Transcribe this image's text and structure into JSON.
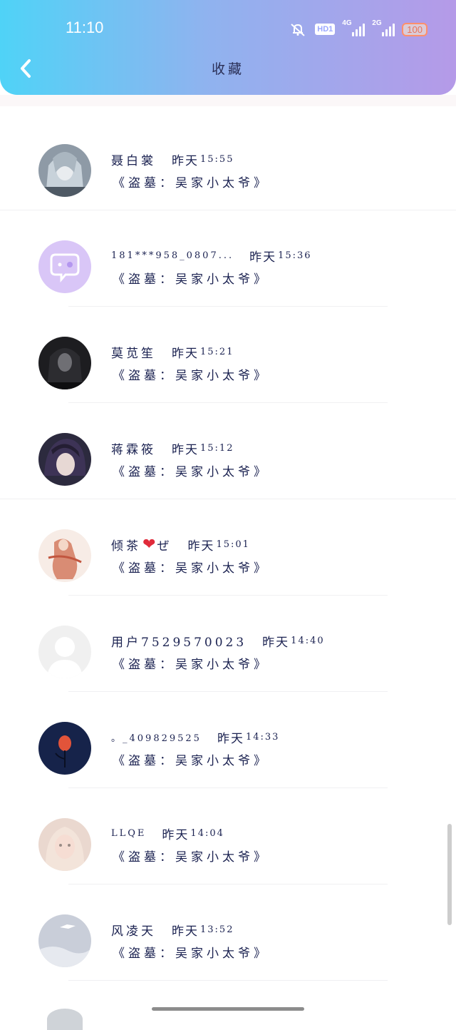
{
  "status_bar": {
    "time": "11:10",
    "hd": "HD1",
    "net1": "4G",
    "net2": "2G",
    "battery": "100"
  },
  "header": {
    "title": "收藏",
    "back_icon": "chevron-left-icon"
  },
  "items": [
    {
      "name": "聂白裳",
      "date": "昨天",
      "time": "15:55",
      "content": "《盗墓：吴家小太爷》",
      "ascii": false
    },
    {
      "name": "181***958_0807...",
      "date": "昨天",
      "time": "15:36",
      "content": "《盗墓：吴家小太爷》",
      "ascii": true
    },
    {
      "name": "莫苋笙",
      "date": "昨天",
      "time": "15:21",
      "content": "《盗墓：吴家小太爷》",
      "ascii": false
    },
    {
      "name": "蒋霖筱",
      "date": "昨天",
      "time": "15:12",
      "content": "《盗墓：吴家小太爷》",
      "ascii": false
    },
    {
      "name": "倾茶",
      "name_suffix": "ぜ",
      "heart": "❤",
      "date": "昨天",
      "time": "15:01",
      "content": "《盗墓：吴家小太爷》",
      "ascii": false
    },
    {
      "name": "用户7529570023",
      "date": "昨天",
      "time": "14:40",
      "content": "《盗墓：吴家小太爷》",
      "ascii": false
    },
    {
      "name": "。_409829525",
      "date": "昨天",
      "time": "14:33",
      "content": "《盗墓：吴家小太爷》",
      "ascii": true
    },
    {
      "name": "LLQE",
      "date": "昨天",
      "time": "14:04",
      "content": "《盗墓：吴家小太爷》",
      "ascii": true
    },
    {
      "name": "风凌天",
      "date": "昨天",
      "time": "13:52",
      "content": "《盗墓：吴家小太爷》",
      "ascii": false
    }
  ]
}
